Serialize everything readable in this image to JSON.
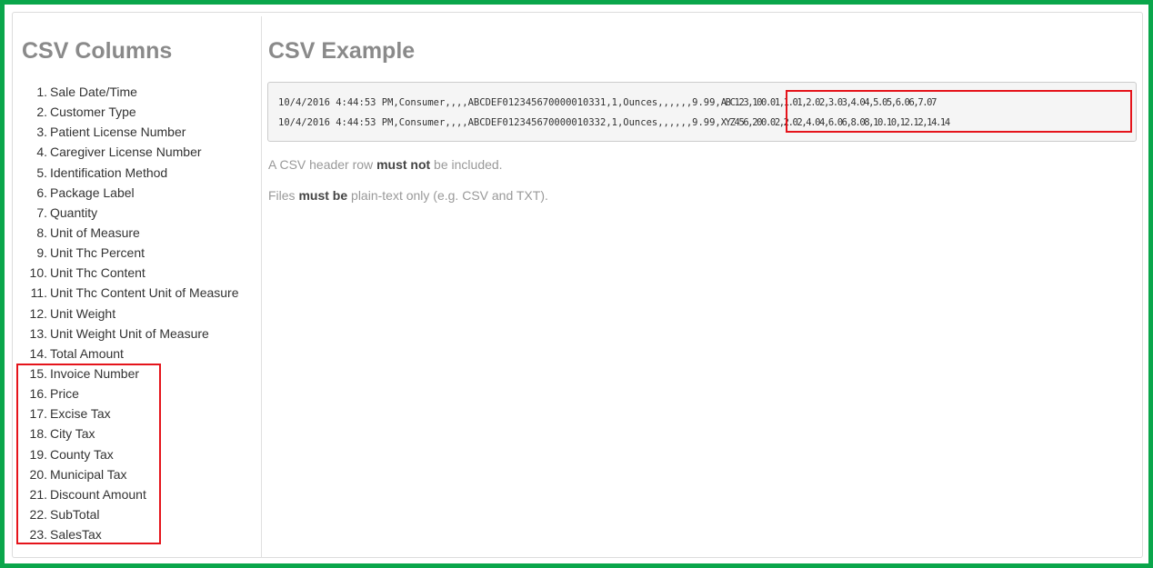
{
  "csv_columns": {
    "title": "CSV Columns",
    "items": [
      {
        "num": "1.",
        "label": "Sale Date/Time"
      },
      {
        "num": "2.",
        "label": "Customer Type"
      },
      {
        "num": "3.",
        "label": "Patient License Number"
      },
      {
        "num": "4.",
        "label": "Caregiver License Number"
      },
      {
        "num": "5.",
        "label": "Identification Method"
      },
      {
        "num": "6.",
        "label": "Package Label"
      },
      {
        "num": "7.",
        "label": "Quantity"
      },
      {
        "num": "8.",
        "label": "Unit of Measure"
      },
      {
        "num": "9.",
        "label": "Unit Thc Percent"
      },
      {
        "num": "10.",
        "label": "Unit Thc Content"
      },
      {
        "num": "11.",
        "label": "Unit Thc Content Unit of Measure"
      },
      {
        "num": "12.",
        "label": "Unit Weight"
      },
      {
        "num": "13.",
        "label": "Unit Weight Unit of Measure"
      },
      {
        "num": "14.",
        "label": "Total Amount"
      },
      {
        "num": "15.",
        "label": "Invoice Number"
      },
      {
        "num": "16.",
        "label": "Price"
      },
      {
        "num": "17.",
        "label": "Excise Tax"
      },
      {
        "num": "18.",
        "label": "City Tax"
      },
      {
        "num": "19.",
        "label": "County Tax"
      },
      {
        "num": "20.",
        "label": "Municipal Tax"
      },
      {
        "num": "21.",
        "label": "Discount Amount"
      },
      {
        "num": "22.",
        "label": "SubTotal"
      },
      {
        "num": "23.",
        "label": "SalesTax"
      }
    ]
  },
  "csv_example": {
    "title": "CSV Example",
    "lines": [
      {
        "prefix": "10/4/2016 4:44:53 PM,Consumer,,,,ABCDEF012345670000010331,1,Ounces,,,,,,9.99,",
        "highlighted": "ABC123,100.01,1.01,2.02,3.03,4.04,5.05,6.06,7.07"
      },
      {
        "prefix": "10/4/2016 4:44:53 PM,Consumer,,,,ABCDEF012345670000010332,1,Ounces,,,,,,9.99,",
        "highlighted": "XYZ456,200.02,2.02,4.04,6.06,8.08,10.10,12.12,14.14"
      }
    ],
    "notes": [
      {
        "before": "A CSV header row ",
        "bold": "must not",
        "after": " be included."
      },
      {
        "before": "Files ",
        "bold": "must be",
        "after": " plain-text only (e.g. CSV and TXT)."
      }
    ]
  },
  "colors": {
    "outer_border": "#0aa64b",
    "highlight_border": "#e5141b",
    "heading": "#8a8a8a",
    "muted_text": "#999999"
  }
}
